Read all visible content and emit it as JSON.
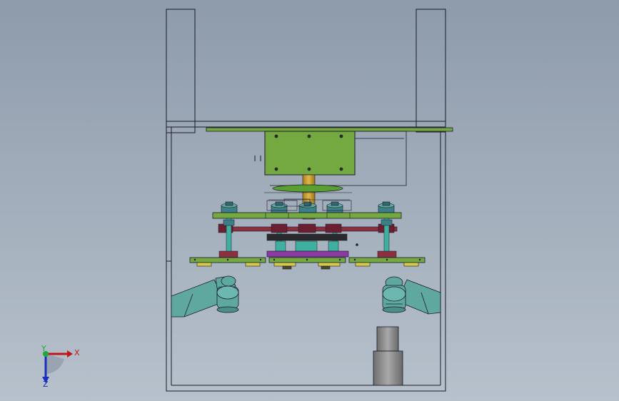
{
  "viewport": {
    "background_top": "#8e9bab",
    "background_bottom": "#b7c1cc"
  },
  "triad": {
    "x_label": "X",
    "y_label": "Y",
    "z_label": "Z",
    "x_color": "#c0181a",
    "y_color": "#1ea83a",
    "z_color": "#1a2dbf"
  },
  "colors": {
    "plate_green": "#74a840",
    "roller_teal": "#5fa8a0",
    "shaft_gold": "#c8a030",
    "link_maroon": "#8a3040",
    "plate_purple": "#8a3aa0",
    "cylinder_gray": "#8c8c8c",
    "pad_yellow": "#d6c84a",
    "outline": "#1a1a2a"
  },
  "icons": {
    "triad": "coordinate-triad-icon"
  }
}
